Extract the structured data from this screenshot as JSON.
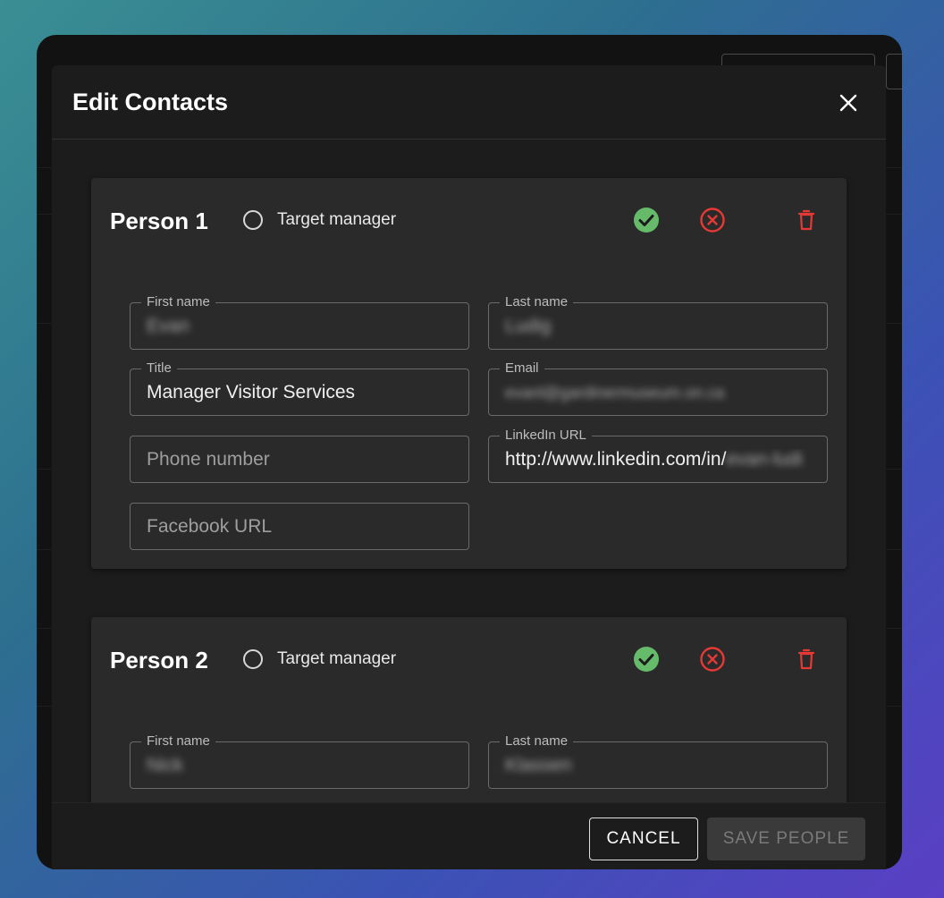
{
  "dialog": {
    "title": "Edit Contacts"
  },
  "persons": [
    {
      "heading": "Person 1",
      "target_label": "Target manager",
      "fields": {
        "first_name": {
          "label": "First name",
          "value": "Evan"
        },
        "last_name": {
          "label": "Last name",
          "value": "Ludig"
        },
        "title": {
          "label": "Title",
          "value": "Manager Visitor Services"
        },
        "email": {
          "label": "Email",
          "value": "evanl@gardinermuseum.on.ca"
        },
        "phone": {
          "placeholder": "Phone number"
        },
        "linkedin": {
          "label": "LinkedIn URL",
          "value_clear": "http://www.linkedin.com/in/",
          "value_blurred": "evan-ludi"
        },
        "facebook": {
          "placeholder": "Facebook URL"
        }
      }
    },
    {
      "heading": "Person 2",
      "target_label": "Target manager",
      "fields": {
        "first_name": {
          "label": "First name",
          "value": "Nick"
        },
        "last_name": {
          "label": "Last name",
          "value": "Klassen"
        }
      }
    }
  ],
  "footer": {
    "cancel_label": "CANCEL",
    "save_label": "SAVE PEOPLE"
  },
  "colors": {
    "confirm": "#66bb6a",
    "reject": "#e53935",
    "delete": "#e53935"
  }
}
